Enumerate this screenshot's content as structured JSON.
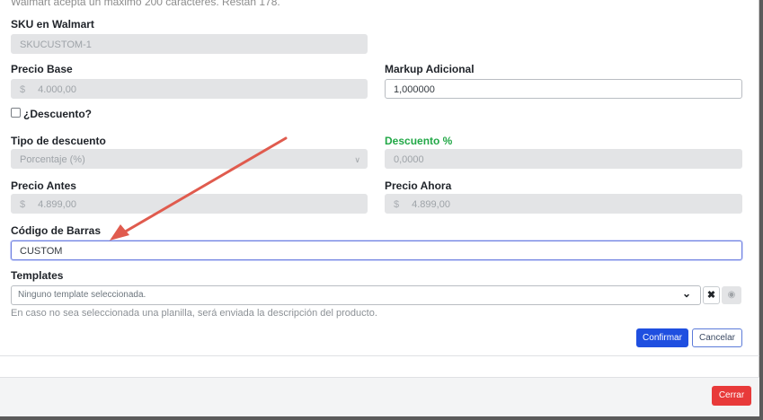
{
  "hint_top": "Walmart acepta un máximo 200 caracteres. Restan 178.",
  "sku": {
    "label": "SKU en Walmart",
    "value": "SKUCUSTOM-1"
  },
  "precio_base": {
    "label": "Precio Base",
    "currency": "$",
    "value": "4.000,00"
  },
  "markup": {
    "label": "Markup Adicional",
    "value": "1,000000"
  },
  "descuento_check": {
    "label": "¿Descuento?",
    "checked": false
  },
  "tipo_descuento": {
    "label": "Tipo de descuento",
    "value": "Porcentaje (%)"
  },
  "descuento_pct": {
    "label": "Descuento %",
    "value": "0,0000",
    "label_color": "#22a847"
  },
  "precio_antes": {
    "label": "Precio Antes",
    "currency": "$",
    "value": "4.899,00"
  },
  "precio_ahora": {
    "label": "Precio Ahora",
    "currency": "$",
    "value": "4.899,00"
  },
  "codigo_barras": {
    "label": "Código de Barras",
    "value": "CUSTOM"
  },
  "templates": {
    "label": "Templates",
    "placeholder": "Ninguno template seleccionada.",
    "help": "En caso no sea seleccionada una planilla, será enviada la descripción del producto."
  },
  "buttons": {
    "confirm": "Confirmar",
    "cancel": "Cancelar",
    "close": "Cerrar"
  },
  "icons": {
    "chevron": "chevron-down-icon",
    "clear": "close-icon",
    "preview": "eye-icon"
  },
  "colors": {
    "primary": "#1f4fe0",
    "danger": "#e83a3a",
    "arrow": "#e05b4e"
  }
}
